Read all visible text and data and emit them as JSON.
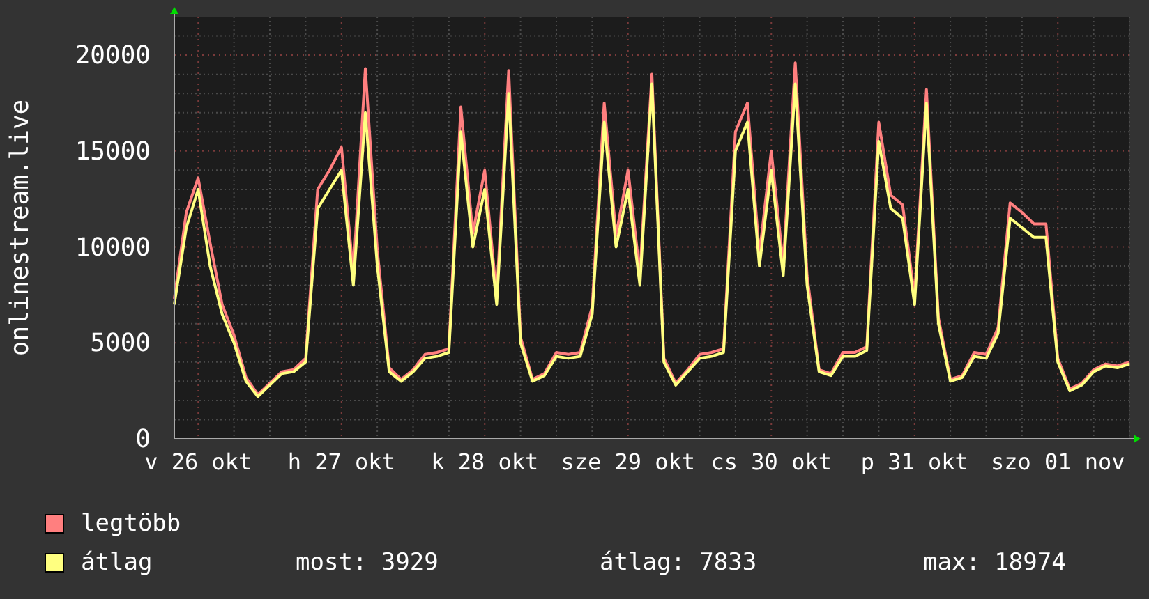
{
  "graph": {
    "chart_data": {
      "type": "line",
      "grid": true,
      "ylabel": "onlinestream.live",
      "ylim": [
        0,
        22000
      ],
      "yticks": [
        0,
        5000,
        10000,
        15000,
        20000
      ],
      "categories": [
        null,
        null,
        "v 26 okt",
        null,
        null,
        null,
        null,
        null,
        null,
        null,
        null,
        null,
        null,
        null,
        "h 27 okt",
        null,
        null,
        null,
        null,
        null,
        null,
        null,
        null,
        null,
        null,
        null,
        "k 28 okt",
        null,
        null,
        null,
        null,
        null,
        null,
        null,
        null,
        null,
        null,
        null,
        "sze 29 okt",
        null,
        null,
        null,
        null,
        null,
        null,
        null,
        null,
        null,
        null,
        null,
        "cs 30 okt",
        null,
        null,
        null,
        null,
        null,
        null,
        null,
        null,
        null,
        null,
        null,
        "p 31 okt",
        null,
        null,
        null,
        null,
        null,
        null,
        null,
        null,
        null,
        null,
        null,
        "szo 01 nov",
        null,
        null,
        null,
        null,
        null,
        null
      ],
      "series": [
        {
          "name": "legtöbb",
          "color": "#ff7f7f",
          "values": [
            7300,
            11800,
            13600,
            10200,
            7000,
            5400,
            3200,
            2300,
            2900,
            3500,
            3600,
            4200,
            13000,
            14000,
            15200,
            8600,
            19300,
            9800,
            3700,
            3100,
            3600,
            4400,
            4500,
            4700,
            17300,
            10700,
            14000,
            7400,
            19200,
            5300,
            3100,
            3400,
            4500,
            4400,
            4500,
            6900,
            17500,
            10600,
            14000,
            8600,
            19000,
            4200,
            2900,
            3600,
            4400,
            4500,
            4700,
            16000,
            17500,
            9600,
            15000,
            9100,
            19600,
            8500,
            3600,
            3400,
            4500,
            4500,
            4800,
            16500,
            12700,
            12200,
            7400,
            18200,
            6300,
            3100,
            3300,
            4500,
            4400,
            5800,
            12300,
            11800,
            11200,
            11200,
            4200,
            2600,
            2900,
            3600,
            3900,
            3800,
            4000
          ]
        },
        {
          "name": "átlag",
          "color": "#ffff80",
          "values": [
            7000,
            11000,
            13000,
            9000,
            6500,
            5000,
            3000,
            2200,
            2800,
            3400,
            3500,
            4000,
            12000,
            13000,
            14000,
            8000,
            17000,
            9000,
            3500,
            3000,
            3500,
            4200,
            4300,
            4500,
            16000,
            10000,
            13000,
            7000,
            18000,
            5000,
            3000,
            3300,
            4300,
            4200,
            4300,
            6500,
            16500,
            10000,
            13000,
            8000,
            18500,
            4000,
            2800,
            3500,
            4200,
            4300,
            4500,
            15000,
            16500,
            9000,
            14000,
            8500,
            18500,
            8000,
            3500,
            3300,
            4300,
            4300,
            4600,
            15500,
            12000,
            11500,
            7000,
            17500,
            6000,
            3000,
            3200,
            4300,
            4200,
            5500,
            11500,
            11000,
            10500,
            10500,
            4000,
            2500,
            2800,
            3500,
            3800,
            3700,
            3900
          ]
        }
      ]
    }
  },
  "legend": {
    "stats": [
      "most: 3929",
      "átlag: 7833",
      "max: 18974"
    ]
  }
}
